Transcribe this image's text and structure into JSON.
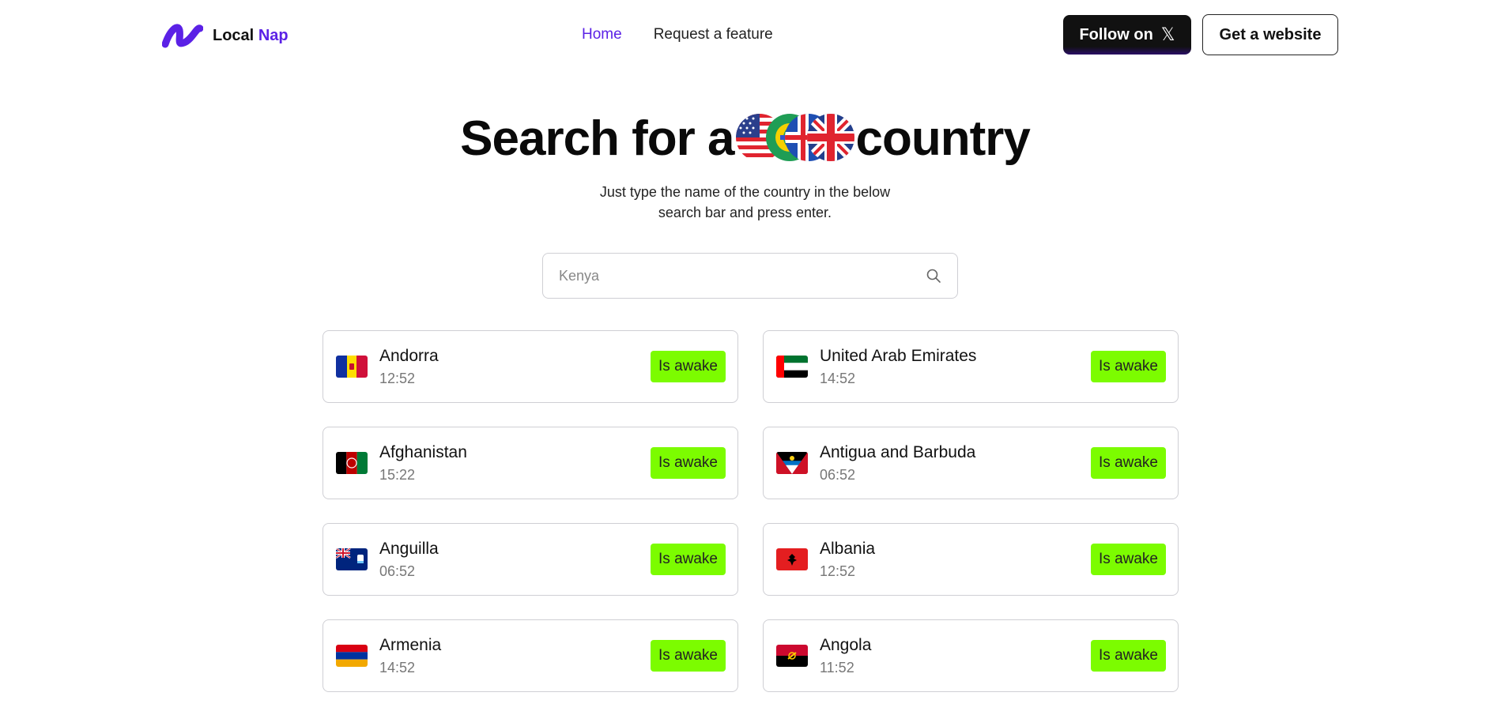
{
  "brand": {
    "name_part1": "Local",
    "name_part2": "Nap"
  },
  "nav": {
    "home": "Home",
    "request": "Request a feature"
  },
  "header_buttons": {
    "follow": "Follow on",
    "follow_icon": "𝕏",
    "website": "Get a website"
  },
  "hero": {
    "title_before": "Search for a",
    "title_after": "country",
    "subtitle_line1": "Just type the name of the country in the below",
    "subtitle_line2": "search bar and press enter."
  },
  "search": {
    "placeholder": "Kenya",
    "value": ""
  },
  "colors": {
    "accent": "#5b21e6",
    "status_bg": "#7cfc00"
  },
  "countries": [
    {
      "name": "Andorra",
      "time": "12:52",
      "status": "Is awake"
    },
    {
      "name": "United Arab Emirates",
      "time": "14:52",
      "status": "Is awake"
    },
    {
      "name": "Afghanistan",
      "time": "15:22",
      "status": "Is awake"
    },
    {
      "name": "Antigua and Barbuda",
      "time": "06:52",
      "status": "Is awake"
    },
    {
      "name": "Anguilla",
      "time": "06:52",
      "status": "Is awake"
    },
    {
      "name": "Albania",
      "time": "12:52",
      "status": "Is awake"
    },
    {
      "name": "Armenia",
      "time": "14:52",
      "status": "Is awake"
    },
    {
      "name": "Angola",
      "time": "11:52",
      "status": "Is awake"
    }
  ]
}
